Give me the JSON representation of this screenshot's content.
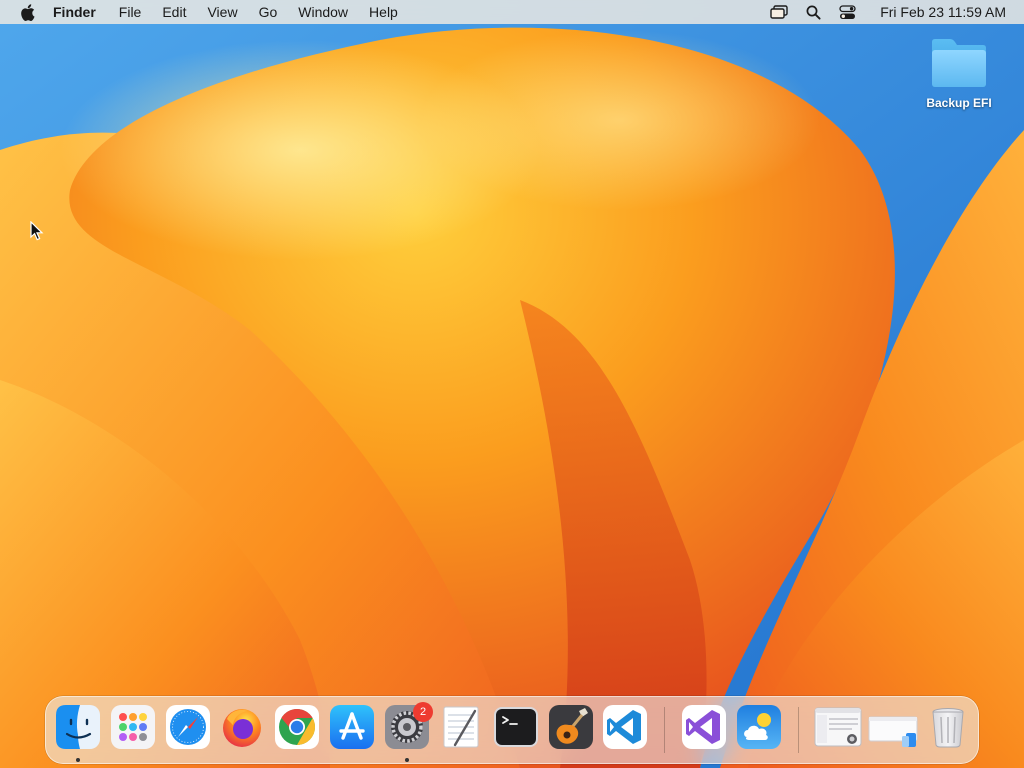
{
  "menubar": {
    "apple_icon": "apple-logo-icon",
    "app_name": "Finder",
    "menus": [
      "File",
      "Edit",
      "View",
      "Go",
      "Window",
      "Help"
    ],
    "status_icons": [
      "screen-mirroring-icon",
      "spotlight-search-icon",
      "control-center-icon"
    ],
    "clock": "Fri Feb 23  11:59 AM"
  },
  "desktop": {
    "items": [
      {
        "label": "Backup EFI",
        "icon": "folder-icon"
      }
    ]
  },
  "dock": {
    "apps": [
      {
        "name": "finder-icon",
        "running": true
      },
      {
        "name": "launchpad-icon",
        "running": false
      },
      {
        "name": "safari-icon",
        "running": false
      },
      {
        "name": "firefox-icon",
        "running": false
      },
      {
        "name": "chrome-icon",
        "running": false
      },
      {
        "name": "app-store-icon",
        "running": false
      },
      {
        "name": "system-settings-icon",
        "running": true,
        "badge": "2"
      },
      {
        "name": "textedit-icon",
        "running": false
      },
      {
        "name": "terminal-icon",
        "running": false
      },
      {
        "name": "garageband-icon",
        "running": false
      },
      {
        "name": "vscode-icon",
        "running": false
      },
      {
        "name": "visual-studio-icon",
        "running": false
      },
      {
        "name": "weather-icon",
        "running": false
      },
      {
        "name": "screenshot-window-icon",
        "running": false
      },
      {
        "name": "migration-window-icon",
        "running": false
      },
      {
        "name": "trash-icon",
        "running": false
      }
    ]
  },
  "colors": {
    "sky_blue": "#2f7fd8",
    "wallpaper_orange": "#f59a1e",
    "badge_red": "#ee3b30"
  }
}
